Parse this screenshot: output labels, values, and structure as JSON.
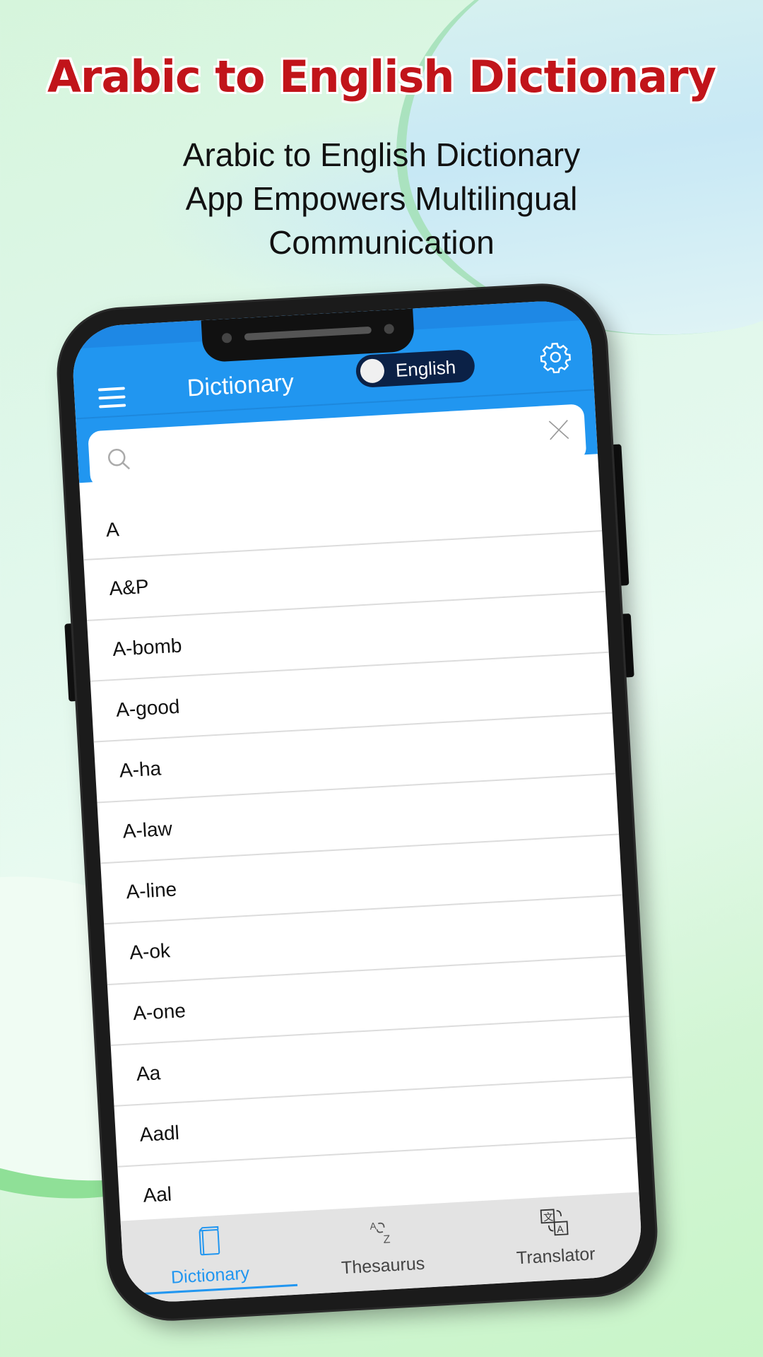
{
  "promo": {
    "headline": "Arabic to English Dictionary",
    "subtitle_lines": [
      "Arabic to English Dictionary",
      "App Empowers Multilingual",
      "Communication"
    ]
  },
  "app": {
    "title": "Dictionary",
    "language_toggle": {
      "label": "English",
      "state": "off"
    },
    "search": {
      "value": "",
      "placeholder": ""
    },
    "colors": {
      "primary": "#2196f0",
      "toggle_bg": "#0b2146",
      "headline": "#c1141a",
      "active_tab": "#2196f0"
    }
  },
  "word_list": [
    "A",
    "A&P",
    "A-bomb",
    "A-good",
    "A-ha",
    "A-law",
    "A-line",
    "A-ok",
    "A-one",
    "Aa",
    "Aadl",
    "Aal"
  ],
  "tabs": [
    {
      "label": "Dictionary",
      "icon": "book-icon",
      "active": true
    },
    {
      "label": "Thesaurus",
      "icon": "a-to-z-swap-icon",
      "active": false
    },
    {
      "label": "Translator",
      "icon": "translate-icon",
      "active": false
    }
  ]
}
